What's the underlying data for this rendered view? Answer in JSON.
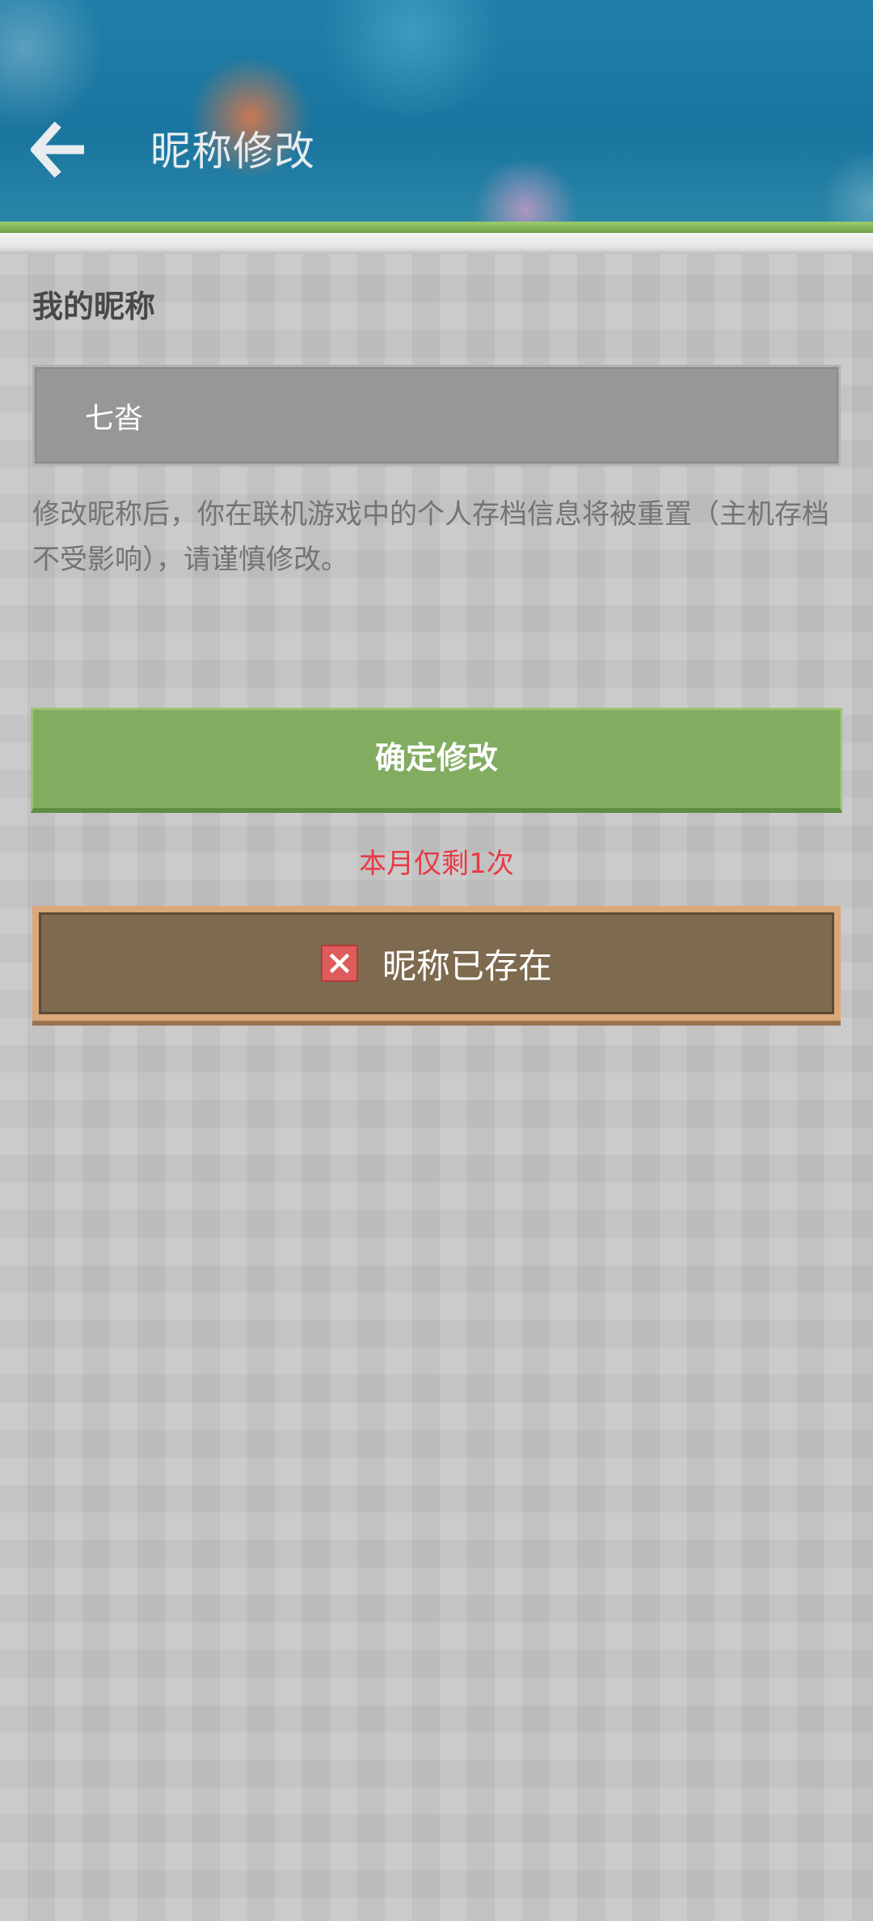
{
  "header": {
    "title": "昵称修改",
    "back_icon": "back-arrow-icon"
  },
  "form": {
    "section_label": "我的昵称",
    "nickname_value": "七沓",
    "warning": "修改昵称后，你在联机游戏中的个人存档信息将被重置（主机存档不受影响），请谨慎修改。",
    "confirm_label": "确定修改",
    "remaining_text": "本月仅剩1次"
  },
  "toast": {
    "icon": "error-x-icon",
    "message": "昵称已存在"
  },
  "colors": {
    "header_bg": "#1a759f",
    "accent_green": "#82ac60",
    "warning_red": "#e53b45",
    "toast_bg": "#7e6a4f"
  }
}
